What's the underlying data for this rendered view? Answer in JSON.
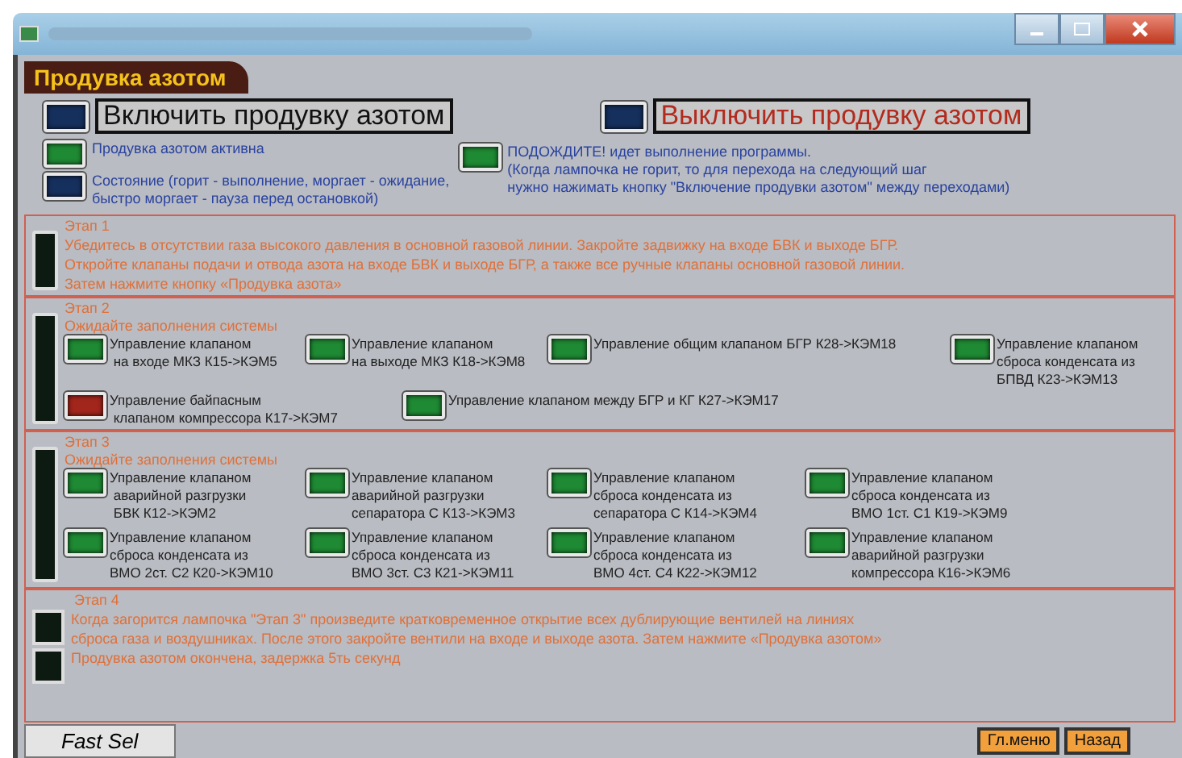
{
  "header": {
    "tab": "Продувка азотом"
  },
  "controls": {
    "start": {
      "label": "Включить продувку азотом",
      "color": "#16305e"
    },
    "stop": {
      "label": "Выключить продувку азотом",
      "color": "#16305e"
    }
  },
  "indicators": [
    {
      "text": "Продувка азотом активна",
      "color": "#1f8a34"
    },
    {
      "text": "Состояние (горит - выполнение, моргает - ожидание,\n быстро моргает - пауза перед остановкой)",
      "color": "#16305e"
    }
  ],
  "notice": {
    "text": "ПОДОЖДИТЕ! идет выполнение программы.\n(Когда лампочка не горит, то для перехода на следующий шаг\nнужно нажимать кнопку \"Включение продувки азотом\" между переходами)",
    "color": "#1f8a34"
  },
  "stage1": {
    "title": "Этап 1",
    "color": "#0d1a12",
    "text": "Убедитесь в отсутствии газа высокого давления в основной газовой линии. Закройте задвижку на входе БВК и выходе БГР.\nОткройте клапаны подачи и отвода азота на входе БВК и выходе БГР, а также все ручные клапаны основной газовой линии.\nЗатем нажмите кнопку «Продувка азота»"
  },
  "stage2": {
    "title": "Этап 2",
    "subtitle": "Ожидайте заполнения системы",
    "color": "#0d1a12",
    "valves": [
      {
        "label": "Управление клапаном\n на входе МКЗ К15->КЭМ5",
        "color": "#1f8a34"
      },
      {
        "label": "Управление клапаном\nна выходе МКЗ К18->КЭМ8",
        "color": "#1f8a34"
      },
      {
        "label": "Управление общим клапаном БГР К28->КЭМ18",
        "color": "#1f8a34"
      },
      {
        "label": "Управление клапаном\nсброса конденсата из\nБПВД К23->КЭМ13",
        "color": "#1f8a34"
      },
      {
        "label": "Управление байпасным\n клапаном компрессора К17->КЭМ7",
        "color": "#a3261c"
      },
      {
        "label": "Управление клапаном между БГР и КГ К27->КЭМ17",
        "color": "#1f8a34"
      }
    ]
  },
  "stage3": {
    "title": "Этап 3",
    "subtitle": "Ожидайте заполнения системы",
    "color": "#0d1a12",
    "valves": [
      {
        "label": "Управление клапаном\n аварийной разгрузки\n БВК К12->КЭМ2",
        "color": "#1f8a34"
      },
      {
        "label": "Управление клапаном\nаварийной разгрузки\nсепаратора С К13->КЭМ3",
        "color": "#1f8a34"
      },
      {
        "label": "Управление клапаном\nсброса конденсата из\nсепаратора С К14->КЭМ4",
        "color": "#1f8a34"
      },
      {
        "label": "Управление клапаном\nсброса конденсата из\nВМО 1ст. С1 К19->КЭМ9",
        "color": "#1f8a34"
      },
      {
        "label": "Управление клапаном\nсброса конденсата из\nВМО 2ст. С2 К20->КЭМ10",
        "color": "#1f8a34"
      },
      {
        "label": "Управление клапаном\nсброса конденсата из\nВМО 3ст. С3 К21->КЭМ11",
        "color": "#1f8a34"
      },
      {
        "label": "Управление клапаном\nсброса конденсата из\nВМО 4ст. С4 К22->КЭМ12",
        "color": "#1f8a34"
      },
      {
        "label": "Управление клапаном\nаварийной разгрузки\nкомпрессора К16->КЭМ6",
        "color": "#1f8a34"
      }
    ]
  },
  "stage4": {
    "title": "Этап 4",
    "steps": [
      {
        "text": "Когда загорится лампочка \"Этап 3\" произведите кратковременное открытие всех дублирующие вентилей на линиях\n сброса газа и воздушниках. После этого закройте вентили на входе и выходе азота. Затем нажмите «Продувка азотом»",
        "color": "#0d1a12"
      },
      {
        "text": "Продувка азотом окончена, задержка 5ть секунд",
        "color": "#0d1a12"
      }
    ]
  },
  "footer": {
    "tab": "Fast Sel",
    "buttons": [
      "Гл.меню",
      "Назад"
    ]
  }
}
